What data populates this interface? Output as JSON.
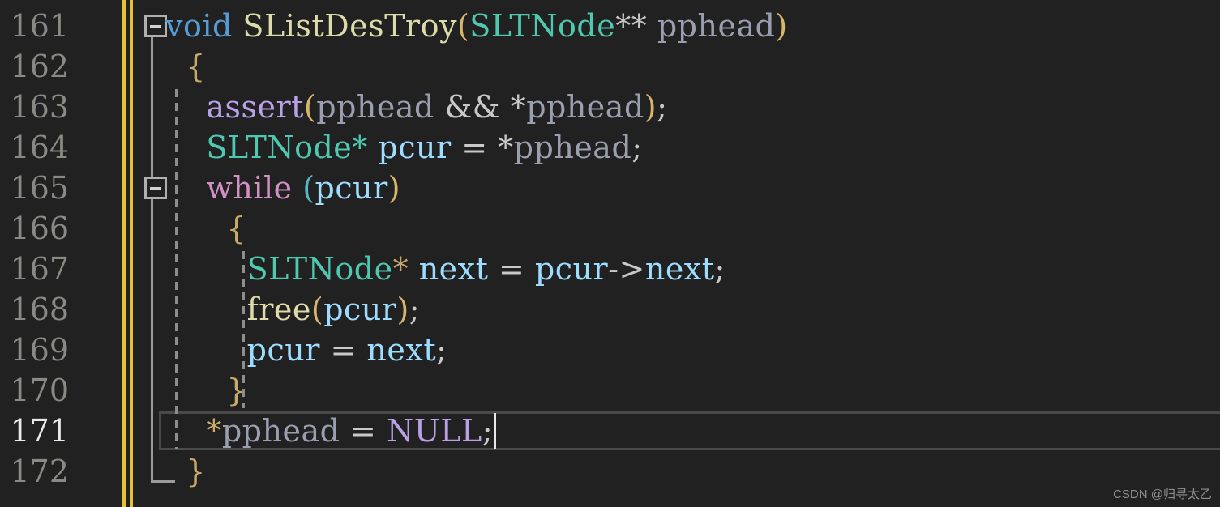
{
  "editor": {
    "background": "#212121",
    "line_height_px": 50,
    "first_visible_line": 161,
    "active_line": 171,
    "change_bar_color": "#e5c233",
    "caret_color": "#e8e8e8"
  },
  "line_numbers": [
    "161",
    "162",
    "163",
    "164",
    "165",
    "166",
    "167",
    "168",
    "169",
    "170",
    "171",
    "172"
  ],
  "code_lines": [
    {
      "number": "161",
      "text": "void SListDesTroy(SLTNode** pphead)",
      "tokens": [
        {
          "t": "void",
          "c": "keyword"
        },
        {
          "t": " ",
          "c": "plain"
        },
        {
          "t": "SListDesTroy",
          "c": "func"
        },
        {
          "t": "(",
          "c": "br1"
        },
        {
          "t": "SLTNode",
          "c": "type"
        },
        {
          "t": "**",
          "c": "op"
        },
        {
          "t": " ",
          "c": "plain"
        },
        {
          "t": "pphead",
          "c": "param"
        },
        {
          "t": ")",
          "c": "br1"
        }
      ]
    },
    {
      "number": "162",
      "text": "{",
      "tokens": [
        {
          "t": "  ",
          "c": "plain"
        },
        {
          "t": "{",
          "c": "brace"
        }
      ]
    },
    {
      "number": "163",
      "text": "    assert(pphead && *pphead);",
      "tokens": [
        {
          "t": "    ",
          "c": "plain"
        },
        {
          "t": "assert",
          "c": "macro"
        },
        {
          "t": "(",
          "c": "br1"
        },
        {
          "t": "pphead",
          "c": "param"
        },
        {
          "t": " ",
          "c": "plain"
        },
        {
          "t": "&&",
          "c": "op"
        },
        {
          "t": " ",
          "c": "plain"
        },
        {
          "t": "*",
          "c": "op"
        },
        {
          "t": "pphead",
          "c": "param"
        },
        {
          "t": ")",
          "c": "br1"
        },
        {
          "t": ";",
          "c": "op"
        }
      ]
    },
    {
      "number": "164",
      "text": "    SLTNode* pcur = *pphead;",
      "tokens": [
        {
          "t": "    ",
          "c": "plain"
        },
        {
          "t": "SLTNode",
          "c": "type"
        },
        {
          "t": "*",
          "c": "type"
        },
        {
          "t": " ",
          "c": "plain"
        },
        {
          "t": "pcur",
          "c": "var"
        },
        {
          "t": " ",
          "c": "plain"
        },
        {
          "t": "=",
          "c": "op"
        },
        {
          "t": " ",
          "c": "plain"
        },
        {
          "t": "*",
          "c": "op"
        },
        {
          "t": "pphead",
          "c": "param"
        },
        {
          "t": ";",
          "c": "op"
        }
      ]
    },
    {
      "number": "165",
      "text": "    while (pcur)",
      "tokens": [
        {
          "t": "    ",
          "c": "plain"
        },
        {
          "t": "while",
          "c": "control"
        },
        {
          "t": " ",
          "c": "plain"
        },
        {
          "t": "(",
          "c": "br2"
        },
        {
          "t": "pcur",
          "c": "var"
        },
        {
          "t": ")",
          "c": "br1"
        }
      ]
    },
    {
      "number": "166",
      "text": "    {",
      "tokens": [
        {
          "t": "      ",
          "c": "plain"
        },
        {
          "t": "{",
          "c": "brace"
        }
      ]
    },
    {
      "number": "167",
      "text": "        SLTNode* next = pcur->next;",
      "tokens": [
        {
          "t": "        ",
          "c": "plain"
        },
        {
          "t": "SLTNode",
          "c": "type"
        },
        {
          "t": "*",
          "c": "brace"
        },
        {
          "t": " ",
          "c": "plain"
        },
        {
          "t": "next",
          "c": "var"
        },
        {
          "t": " ",
          "c": "plain"
        },
        {
          "t": "=",
          "c": "op"
        },
        {
          "t": " ",
          "c": "plain"
        },
        {
          "t": "pcur",
          "c": "var"
        },
        {
          "t": "->",
          "c": "op"
        },
        {
          "t": "next",
          "c": "member"
        },
        {
          "t": ";",
          "c": "op"
        }
      ]
    },
    {
      "number": "168",
      "text": "        free(pcur);",
      "tokens": [
        {
          "t": "        ",
          "c": "plain"
        },
        {
          "t": "free",
          "c": "func"
        },
        {
          "t": "(",
          "c": "br1"
        },
        {
          "t": "pcur",
          "c": "var"
        },
        {
          "t": ")",
          "c": "br1"
        },
        {
          "t": ";",
          "c": "op"
        }
      ]
    },
    {
      "number": "169",
      "text": "        pcur = next;",
      "tokens": [
        {
          "t": "        ",
          "c": "plain"
        },
        {
          "t": "pcur",
          "c": "var"
        },
        {
          "t": " ",
          "c": "plain"
        },
        {
          "t": "=",
          "c": "op"
        },
        {
          "t": " ",
          "c": "plain"
        },
        {
          "t": "next",
          "c": "var"
        },
        {
          "t": ";",
          "c": "op"
        }
      ]
    },
    {
      "number": "170",
      "text": "    }",
      "tokens": [
        {
          "t": "      ",
          "c": "plain"
        },
        {
          "t": "}",
          "c": "brace"
        }
      ]
    },
    {
      "number": "171",
      "text": "    *pphead = NULL;",
      "tokens": [
        {
          "t": "    ",
          "c": "plain"
        },
        {
          "t": "*",
          "c": "brace"
        },
        {
          "t": "pphead",
          "c": "param"
        },
        {
          "t": " ",
          "c": "plain"
        },
        {
          "t": "=",
          "c": "op"
        },
        {
          "t": " ",
          "c": "plain"
        },
        {
          "t": "NULL",
          "c": "macro"
        },
        {
          "t": ";",
          "c": "op"
        }
      ]
    },
    {
      "number": "172",
      "text": "}",
      "tokens": [
        {
          "t": "  ",
          "c": "plain"
        },
        {
          "t": "}",
          "c": "brace"
        }
      ]
    }
  ],
  "fold_boxes": [
    {
      "line": "161",
      "state": "expanded"
    },
    {
      "line": "165",
      "state": "expanded"
    }
  ],
  "watermark": {
    "text": "CSDN @归寻太乙"
  },
  "palette": {
    "keyword": "#569cd6",
    "control": "#d191c4",
    "function": "#dcdcaa",
    "type": "#4ec9b0",
    "variable": "#9cdcfe",
    "parameter": "#9a9fb0",
    "macro": "#b9a0e8",
    "plain": "#d4d4d4",
    "bracket1": "#d7b56a",
    "bracket2": "#58b6c4",
    "line_number": "#8a8a85",
    "line_number_active": "#eaeaea",
    "background": "#212121"
  }
}
